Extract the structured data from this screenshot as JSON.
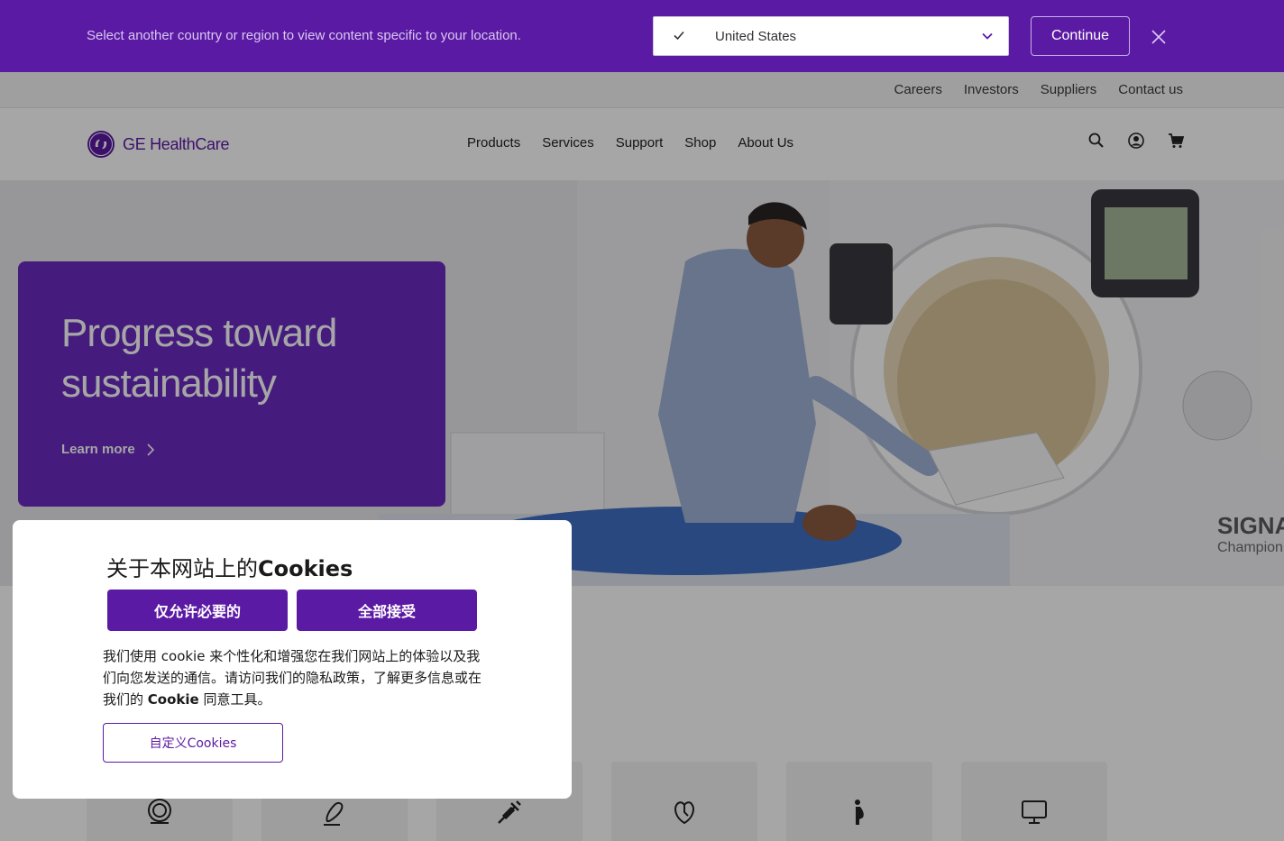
{
  "country_banner": {
    "message": "Select another country or region to view content specific to your location.",
    "selected_country": "United States",
    "continue_label": "Continue"
  },
  "utility_nav": {
    "links": [
      "Careers",
      "Investors",
      "Suppliers",
      "Contact us"
    ]
  },
  "main_nav": {
    "logo_text": "GE HealthCare",
    "links": [
      "Products",
      "Services",
      "Support",
      "Shop",
      "About Us"
    ],
    "icons": [
      "search-icon",
      "user-icon",
      "cart-icon"
    ]
  },
  "hero": {
    "title": "Progress toward sustainability",
    "link_label": "Learn more"
  },
  "category_tiles": [
    "mri-scanner-icon",
    "ultrasound-probe-icon",
    "syringe-icon",
    "heart-icon",
    "pregnancy-icon",
    "monitor-icon"
  ],
  "cookie_dialog": {
    "title_prefix": "关于本网站上的",
    "title_bold": "Cookies",
    "necessary_label": "仅允许必要的",
    "accept_label": "全部接受",
    "body_text": "我们使用 cookie 来个性化和增强您在我们网站上的体验以及我们向您发送的通信。请访问我们的隐私政策，了解更多信息或在我们的",
    "body_bold": "Cookie",
    "body_suffix": "同意工具。",
    "customize_label": "自定义Cookies"
  },
  "colors": {
    "brand_purple": "#5b1aa3",
    "hero_card": "#6b2cc0"
  }
}
